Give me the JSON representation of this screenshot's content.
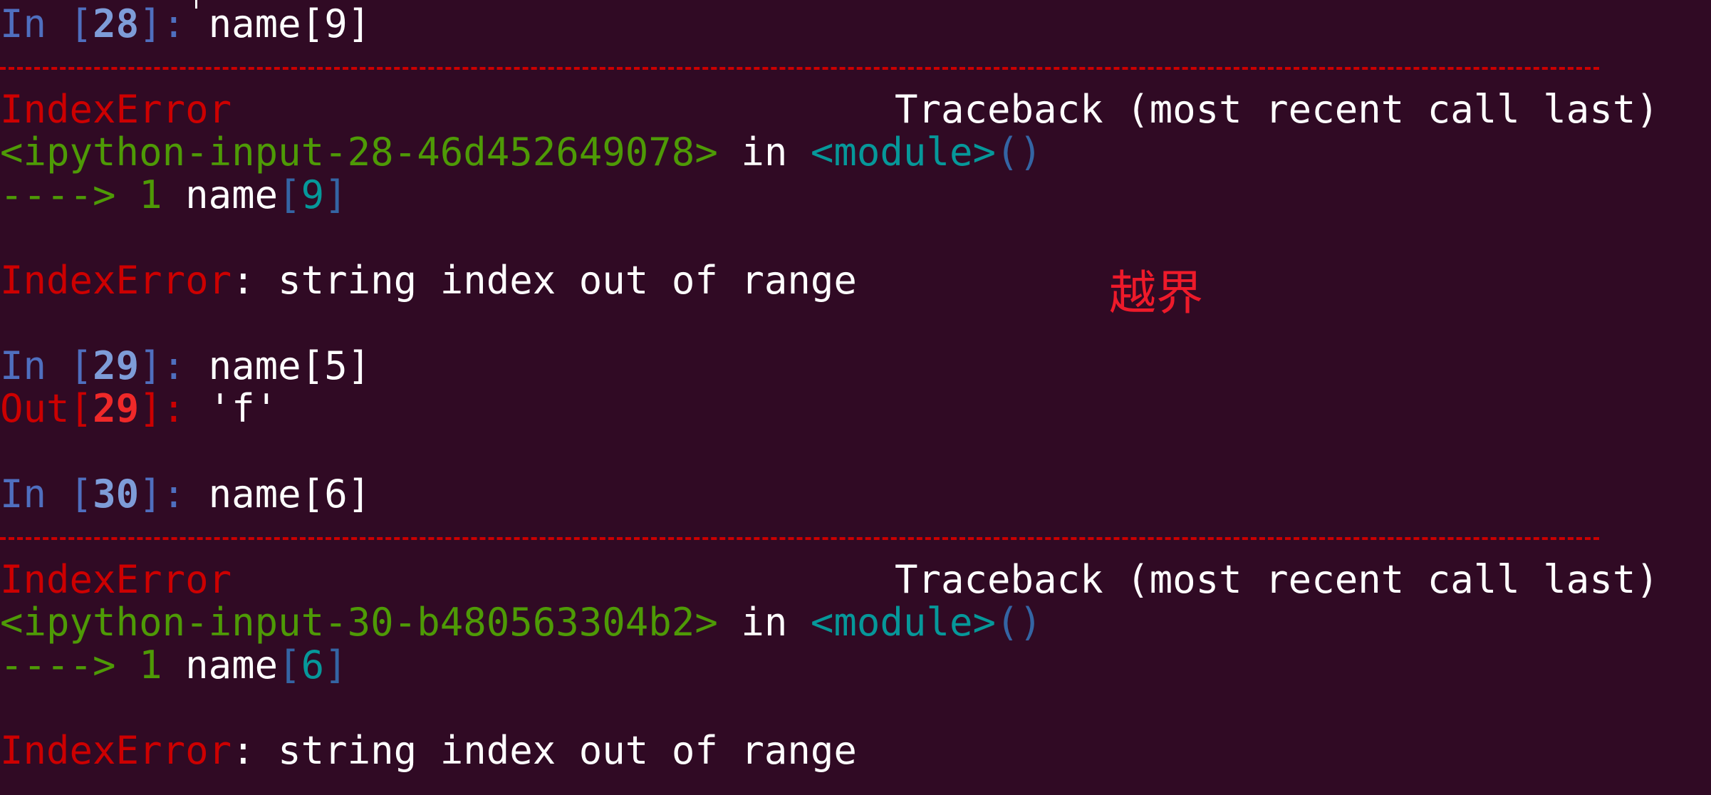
{
  "cells": [
    {
      "in_label": "In ",
      "in_num": "28",
      "code": "name[9]"
    },
    {
      "in_label": "In ",
      "in_num": "29",
      "code": "name[5]",
      "out_label": "Out",
      "out_num": "29",
      "output": "'f'"
    },
    {
      "in_label": "In ",
      "in_num": "30",
      "code": "name[6]"
    }
  ],
  "tracebacks": [
    {
      "error_name": "IndexError",
      "traceback_header": "Traceback (most recent call last)",
      "input_ref": "<ipython-input-28-46d452649078>",
      "in_word": " in ",
      "module": "<module>",
      "parens": "()",
      "arrow": "----> ",
      "line_no": "1",
      "code_name": " name",
      "code_index_open": "[",
      "code_index": "9",
      "code_index_close": "]",
      "error_message": ": string index out of range"
    },
    {
      "error_name": "IndexError",
      "traceback_header": "Traceback (most recent call last)",
      "input_ref": "<ipython-input-30-b480563304b2>",
      "in_word": " in ",
      "module": "<module>",
      "parens": "()",
      "arrow": "----> ",
      "line_no": "1",
      "code_name": " name",
      "code_index_open": "[",
      "code_index": "6",
      "code_index_close": "]",
      "error_message": ": string index out of range"
    }
  ],
  "annotation": "越界",
  "colors": {
    "background": "#300a24",
    "error": "#cc0000",
    "prompt": "#4f6fbf",
    "green": "#4e9a06",
    "cyan": "#06989a",
    "annotation": "#ee1a2a"
  }
}
